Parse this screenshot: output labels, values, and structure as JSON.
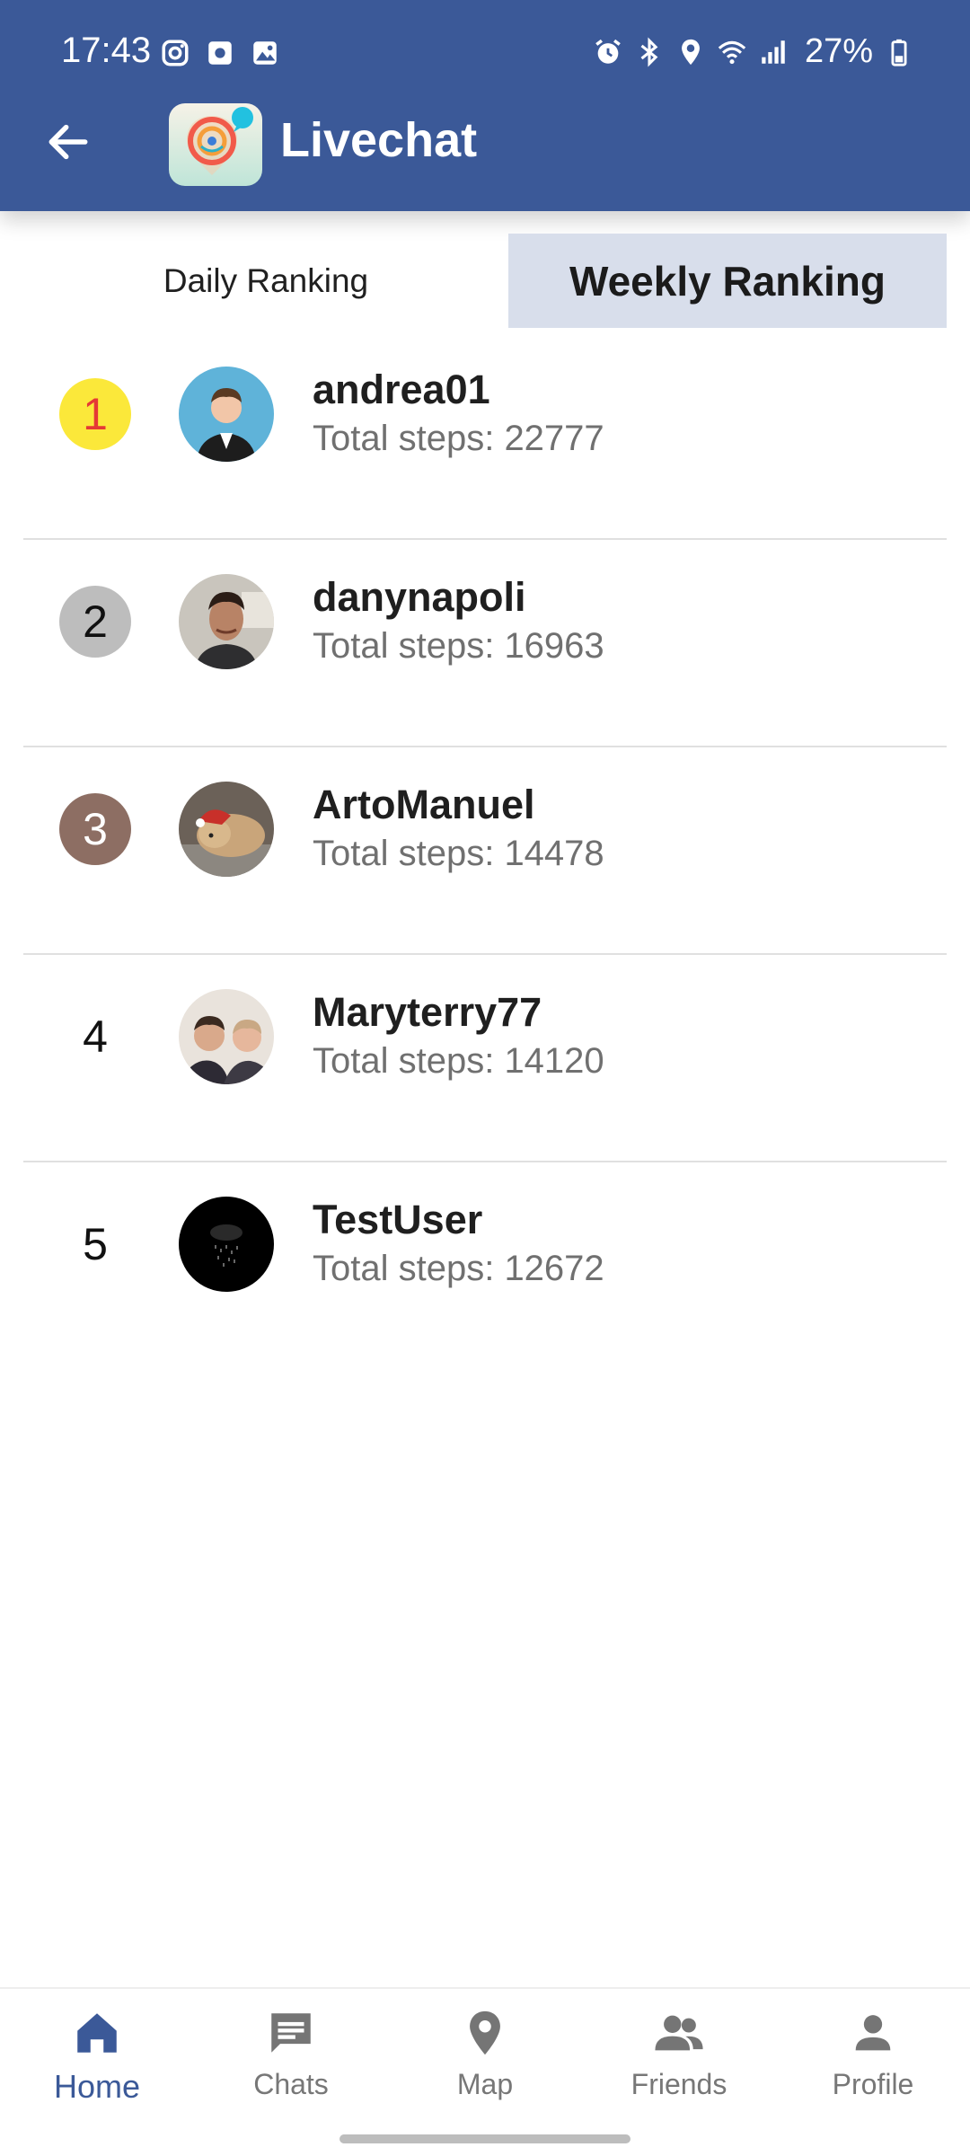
{
  "status_bar": {
    "time": "17:43",
    "battery": "27%"
  },
  "app_bar": {
    "title": "Livechat"
  },
  "tabs": [
    {
      "label": "Daily Ranking",
      "selected": false
    },
    {
      "label": "Weekly Ranking",
      "selected": true
    }
  ],
  "ranking": [
    {
      "rank": "1",
      "name": "andrea01",
      "steps": "Total steps: 22777"
    },
    {
      "rank": "2",
      "name": "danynapoli",
      "steps": "Total steps: 16963"
    },
    {
      "rank": "3",
      "name": "ArtoManuel",
      "steps": "Total steps: 14478"
    },
    {
      "rank": "4",
      "name": "Maryterry77",
      "steps": "Total steps: 14120"
    },
    {
      "rank": "5",
      "name": "TestUser",
      "steps": "Total steps: 12672"
    }
  ],
  "bottom_nav": [
    {
      "label": "Home",
      "icon": "home-icon",
      "active": true
    },
    {
      "label": "Chats",
      "icon": "chat-icon",
      "active": false
    },
    {
      "label": "Map",
      "icon": "map-pin-icon",
      "active": false
    },
    {
      "label": "Friends",
      "icon": "friends-icon",
      "active": false
    },
    {
      "label": "Profile",
      "icon": "person-icon",
      "active": false
    }
  ],
  "colors": {
    "primary": "#3b5998",
    "selected_tab": "#d8deeb",
    "gold": "#fbe83a",
    "silver": "#bdbdbd",
    "bronze": "#8d6e63"
  }
}
